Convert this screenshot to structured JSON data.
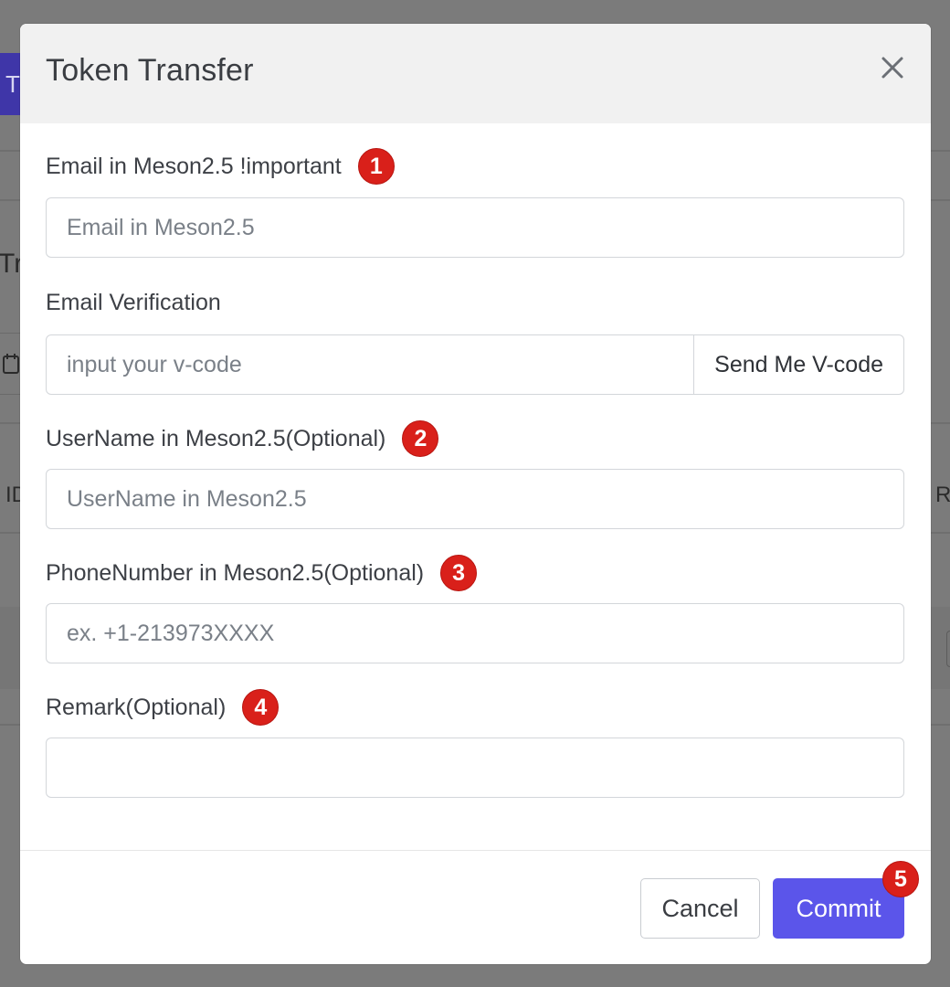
{
  "background": {
    "button_fragment": "T",
    "heading_fragment": "Tr",
    "col_fragment_left": "ID",
    "col_fragment_right": "R"
  },
  "modal": {
    "title": "Token Transfer",
    "close_icon": "close-icon"
  },
  "form": {
    "email": {
      "label": "Email in Meson2.5 !important",
      "badge": "1",
      "placeholder": "Email in Meson2.5",
      "value": ""
    },
    "verification": {
      "label": "Email Verification",
      "placeholder": "input your v-code",
      "value": "",
      "send_button": "Send Me V-code"
    },
    "username": {
      "label": "UserName in Meson2.5(Optional)",
      "badge": "2",
      "placeholder": "UserName in Meson2.5",
      "value": ""
    },
    "phone": {
      "label": "PhoneNumber in Meson2.5(Optional)",
      "badge": "3",
      "placeholder": "ex. +1-213973XXXX",
      "value": ""
    },
    "remark": {
      "label": "Remark(Optional)",
      "badge": "4",
      "placeholder": "",
      "value": ""
    }
  },
  "footer": {
    "cancel_label": "Cancel",
    "commit_label": "Commit",
    "commit_badge": "5"
  },
  "colors": {
    "accent": "#5b55ea",
    "badge": "#d9201a",
    "overlay": "#7b7b7b",
    "header_bg": "#f1f1f1"
  }
}
